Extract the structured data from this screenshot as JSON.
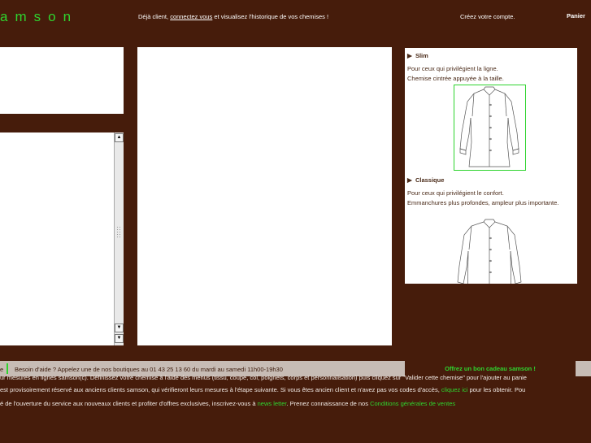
{
  "header": {
    "logo": "amson",
    "login_prefix": "Déjà client, ",
    "login_link": "connectez vous",
    "login_suffix": " et visualisez l'historique de vos chemises !",
    "create_account": "Créez votre compte.",
    "cart": "Panier"
  },
  "scrollbar": {
    "up_arrow": "▲",
    "down_arrow": "▼"
  },
  "options": [
    {
      "title": "Slim",
      "lines": [
        "Pour ceux qui privilégient la ligne.",
        "Chemise cintrée appuyée à la taille."
      ],
      "selected": true
    },
    {
      "title": "Classique",
      "lines": [
        "Pour ceux qui privilégient le confort.",
        "Emmanchures plus profondes, ampleur plus importante."
      ],
      "selected": false
    }
  ],
  "bullet": "▶",
  "help_bar": {
    "left_fragment": "e",
    "text": "Besoin d'aide ? Appelez une de nos boutiques au 01 43 25 13 60 du mardi au samedi 11h00-19h30"
  },
  "gift": "Offrez un bon cadeau samson !",
  "footer": {
    "line1": "ur mesures en lignes samson(c). Définissez votre chemise à l'aide des menus (tissu, coupe, col, poignets, corps et personnalisation) puis cliquez sur \"Valider cette chemise\" pour l'ajouter au panie",
    "line2_a": " est provisoirement réservé aux anciens clients samson, qui vérifieront leurs mesures à l'étape suivante. Si vous êtes ancien client et n'avez pas vos codes d'accès, ",
    "line2_link": "cliquez ici",
    "line2_b": " pour les obtenir. Pou",
    "line3_a": "é de l'ouverture du service aux nouveaux clients et profiter d'offres exclusives, inscrivez-vous à ",
    "line3_link1": "news letter",
    "line3_b": ". Prenez connaissance de nos ",
    "line3_link2": "Conditions générales de ventes"
  },
  "colors": {
    "background": "#461c0b",
    "accent_green": "#2fd42f",
    "help_bar_bg": "#c7bcb5"
  }
}
